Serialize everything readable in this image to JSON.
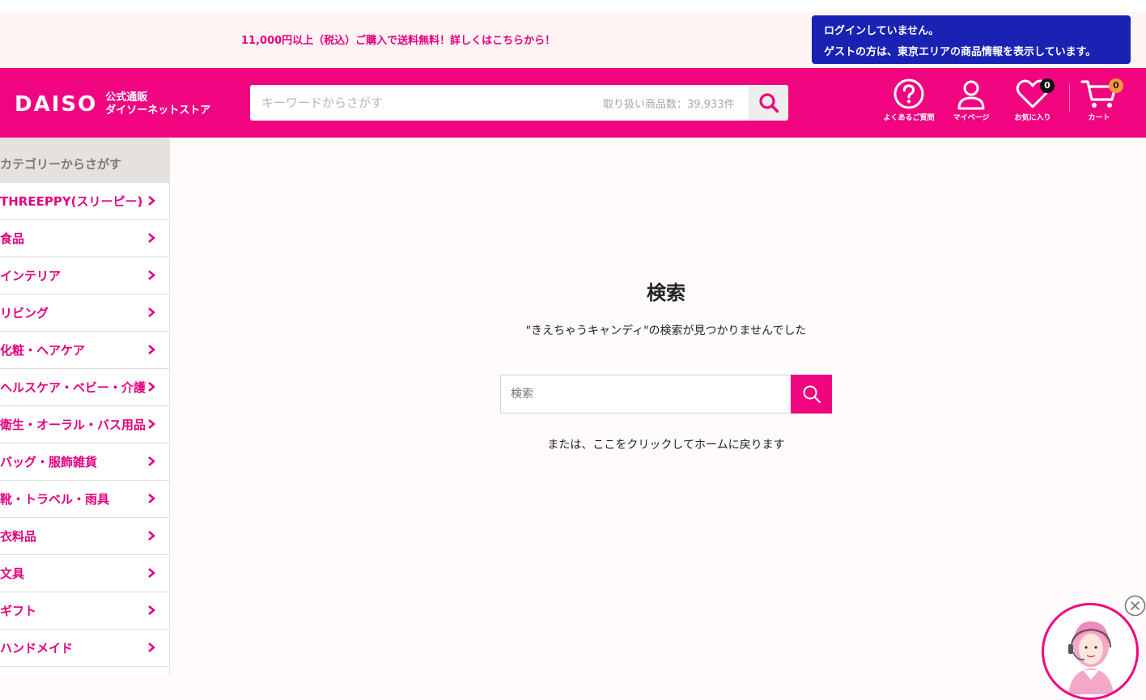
{
  "announcement": {
    "text": "11,000円以上（税込）ご購入で送料無料！詳しくはこちらから！"
  },
  "login_notice": {
    "line1": "ログインしていません。",
    "line2": "ゲストの方は、東京エリアの商品情報を表示しています。"
  },
  "logo": {
    "main": "DAISO",
    "sub_line1": "公式通販",
    "sub_line2": "ダイソーネットストア"
  },
  "header_search": {
    "placeholder": "キーワードからさがす",
    "count_text": "取り扱い商品数：39,933件"
  },
  "header_icons": {
    "faq": {
      "label": "よくあるご質問",
      "icon": "question-circle-icon"
    },
    "mypage": {
      "label": "マイページ",
      "icon": "user-icon"
    },
    "favorites": {
      "label": "お気に入り",
      "icon": "heart-icon",
      "count": "0"
    },
    "cart": {
      "label": "カート",
      "icon": "cart-icon",
      "count": "0"
    }
  },
  "sidebar": {
    "title": "カテゴリーからさがす",
    "items": [
      {
        "label": "THREEPPY(スリーピー)"
      },
      {
        "label": "食品"
      },
      {
        "label": "インテリア"
      },
      {
        "label": "リビング"
      },
      {
        "label": "化粧・ヘアケア"
      },
      {
        "label": "ヘルスケア・ベビー・介護"
      },
      {
        "label": "衛生・オーラル・バス用品"
      },
      {
        "label": "バッグ・服飾雑貨"
      },
      {
        "label": "靴・トラベル・雨具"
      },
      {
        "label": "衣料品"
      },
      {
        "label": "文具"
      },
      {
        "label": "ギフト"
      },
      {
        "label": "ハンドメイド"
      }
    ]
  },
  "main": {
    "title": "検索",
    "message": "\"きえちゃうキャンディ\"の検索が見つかりませんでした",
    "search_placeholder": "検索",
    "home_link": "または、ここをクリックしてホームに戻ります"
  },
  "colors": {
    "brand_pink": "#f0047f",
    "login_blue": "#1a22b4",
    "badge_black": "#111111",
    "badge_orange": "#f29a38"
  }
}
